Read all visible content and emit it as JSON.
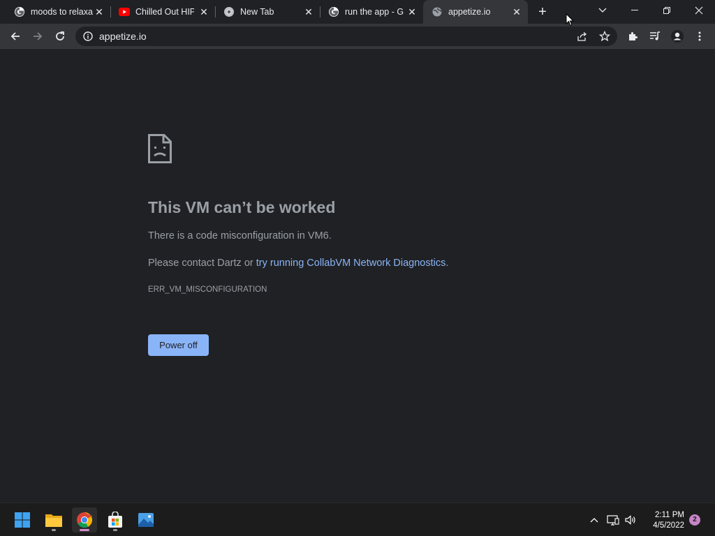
{
  "tabs": [
    {
      "title": "moods to relaxa",
      "favicon": "google-icon"
    },
    {
      "title": "Chilled Out HIP-",
      "favicon": "youtube-icon"
    },
    {
      "title": "New Tab",
      "favicon": "chrome-icon"
    },
    {
      "title": "run the app - Go",
      "favicon": "google-icon"
    },
    {
      "title": "appetize.io",
      "favicon": "globe-icon",
      "active": true
    }
  ],
  "address_bar": {
    "url": "appetize.io"
  },
  "error_page": {
    "title": "This VM can’t be worked",
    "line1": "There is a code misconfiguration in VM6.",
    "line2_prefix": "Please contact Dartz or ",
    "line2_link": "try running CollabVM Network Diagnostics",
    "line2_suffix": ".",
    "error_code": "ERR_VM_MISCONFIGURATION",
    "button_label": "Power off"
  },
  "taskbar": {
    "apps": [
      "start-icon",
      "file-explorer-icon",
      "chrome-icon",
      "store-icon",
      "photos-icon"
    ],
    "clock_time": "2:11 PM",
    "clock_date": "4/5/2022",
    "notification_count": "2"
  },
  "colors": {
    "page_bg": "#202124",
    "toolbar_bg": "#35363a",
    "link": "#8ab4f8",
    "muted_text": "#9aa0a6"
  }
}
